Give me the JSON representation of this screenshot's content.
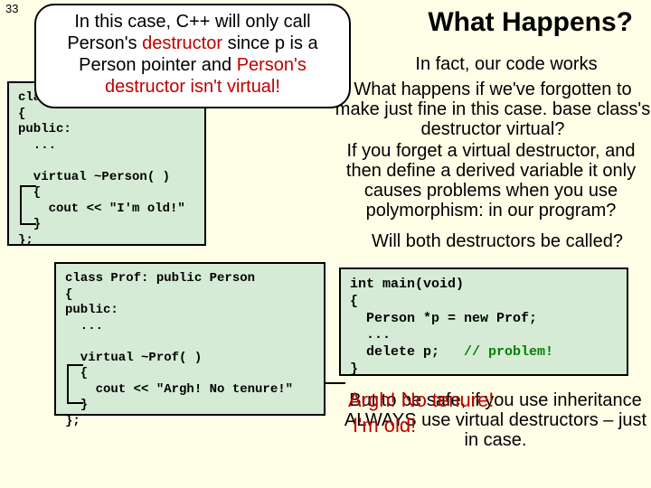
{
  "slideNumber": "33",
  "heading": "What Happens?",
  "callout": {
    "line1": "In this case, C++ will only call",
    "line2a": "Person's ",
    "line2b": "destructor",
    "line2c": " since p is a",
    "line3a": "Person pointer and ",
    "line3b": "Person's",
    "line4": "destructor isn't virtual!"
  },
  "codePerson": "class Person\n{\npublic:\n  ...\n\n  virtual ~Person( )\n  {\n    cout << \"I'm old!\"\n  }\n};",
  "codeProf": "class Prof: public Person\n{\npublic:\n  ...\n\n  virtual ~Prof( )\n  {\n    cout << \"Argh! No tenure!\"\n  }\n};",
  "codeMain": {
    "l1": "int main(void)",
    "l2": "{",
    "l3": "  Person *p = new Prof;",
    "l4": "  ...",
    "l5a": "  delete p;   ",
    "l5b": "// problem!",
    "l6": "}"
  },
  "txt1": "In fact, our code works",
  "txt2": "What happens if we've forgotten to make just fine in this case. base class's destructor virtual?",
  "txt3": "If you forget a virtual destructor, and then define a derived variable it only causes problems when you use polymorphism: in our program?",
  "txt5": "Will both destructors be called?",
  "txt6": "But to be safe, if you use inheritance ALWAYS use virtual destructors – just in case.",
  "out1": "Argh! No tenure!",
  "out2": "I'm old!"
}
